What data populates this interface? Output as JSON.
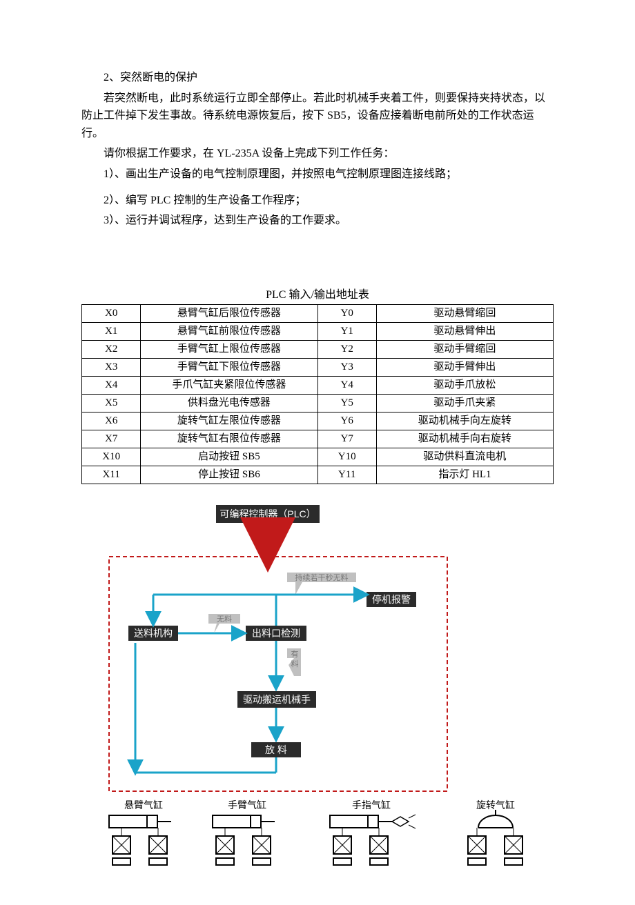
{
  "paragraphs": {
    "p1": "2、突然断电的保护",
    "p2": "若突然断电，此时系统运行立即全部停止。若此时机械手夹着工件，则要保持夹持状态，以防止工件掉下发生事故。待系统电源恢复后，按下 SB5，设备应接着断电前所处的工作状态运行。",
    "p3": "请你根据工作要求，在 YL-235A 设备上完成下列工作任务：",
    "p4": "1）、画出生产设备的电气控制原理图，并按照电气控制原理图连接线路；",
    "p5": "2）、编写 PLC 控制的生产设备工作程序；",
    "p6": "3）、运行并调试程序，达到生产设备的工作要求。"
  },
  "table_title": "PLC 输入/输出地址表",
  "io_table": [
    {
      "in_code": "X0",
      "in_desc": "悬臂气缸后限位传感器",
      "out_code": "Y0",
      "out_desc": "驱动悬臂缩回"
    },
    {
      "in_code": "X1",
      "in_desc": "悬臂气缸前限位传感器",
      "out_code": "Y1",
      "out_desc": "驱动悬臂伸出"
    },
    {
      "in_code": "X2",
      "in_desc": "手臂气缸上限位传感器",
      "out_code": "Y2",
      "out_desc": "驱动手臂缩回"
    },
    {
      "in_code": "X3",
      "in_desc": "手臂气缸下限位传感器",
      "out_code": "Y3",
      "out_desc": "驱动手臂伸出"
    },
    {
      "in_code": "X4",
      "in_desc": "手爪气缸夹紧限位传感器",
      "out_code": "Y4",
      "out_desc": "驱动手爪放松"
    },
    {
      "in_code": "X5",
      "in_desc": "供料盘光电传感器",
      "out_code": "Y5",
      "out_desc": "驱动手爪夹紧"
    },
    {
      "in_code": "X6",
      "in_desc": "旋转气缸左限位传感器",
      "out_code": "Y6",
      "out_desc": "驱动机械手向左旋转"
    },
    {
      "in_code": "X7",
      "in_desc": "旋转气缸右限位传感器",
      "out_code": "Y7",
      "out_desc": "驱动机械手向右旋转"
    },
    {
      "in_code": "X10",
      "in_desc": "启动按钮 SB5",
      "out_code": "Y10",
      "out_desc": "驱动供料直流电机"
    },
    {
      "in_code": "X11",
      "in_desc": "停止按钮 SB6",
      "out_code": "Y11",
      "out_desc": "指示灯 HL1"
    }
  ],
  "diagram": {
    "plc": "可编程控制器（PLC）",
    "alarm": "停机报警",
    "feed": "送料机构",
    "detect": "出料口检测",
    "drive_arm": "驱动搬运机械手",
    "place": "放  料",
    "note_timeout": "持续若干秒无料",
    "note_nomat": "无料",
    "note_hasmat": "有料",
    "cyl_labels": {
      "boom": "悬臂气缸",
      "arm": "手臂气缸",
      "finger": "手指气缸",
      "rotate": "旋转气缸"
    }
  }
}
